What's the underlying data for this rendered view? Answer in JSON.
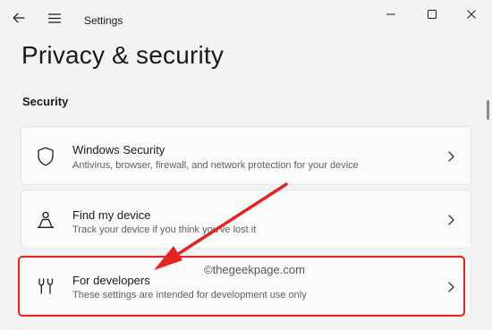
{
  "window": {
    "title": "Settings",
    "back_icon": "back-arrow-icon",
    "menu_icon": "hamburger-menu-icon",
    "minimize_icon": "minimize-icon",
    "maximize_icon": "maximize-icon",
    "close_icon": "close-icon"
  },
  "page": {
    "title": "Privacy & security",
    "section": "Security"
  },
  "items": [
    {
      "title": "Windows Security",
      "description": "Antivirus, browser, firewall, and network protection for your device",
      "icon": "shield-icon"
    },
    {
      "title": "Find my device",
      "description": "Track your device if you think you've lost it",
      "icon": "person-location-icon"
    },
    {
      "title": "For developers",
      "description": "These settings are intended for development use only",
      "icon": "developer-tools-icon"
    }
  ],
  "watermark": "©thegeekpage.com",
  "colors": {
    "highlight": "#e32424",
    "background": "#f3f3f3",
    "card": "#fbfbfb"
  }
}
